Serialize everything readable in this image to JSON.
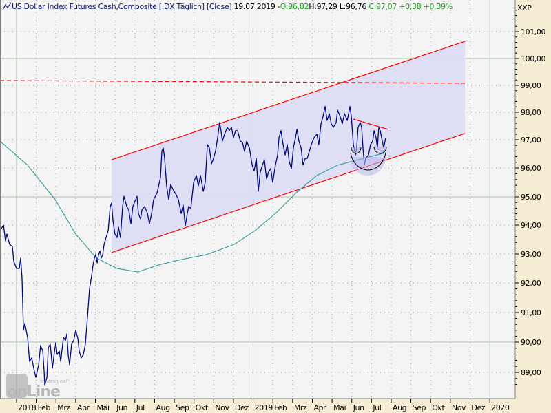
{
  "header": {
    "instrument": "US Dollar Index Futures Cash,Composite [.DX  Täglich] [Close]",
    "date": "19.07.2019",
    "sep": "-",
    "open": "O:96,82",
    "high": "H:97,29",
    "low": "L:96,76",
    "close": "C:97,07",
    "change": "+0,38",
    "change_pct": "+0,39%"
  },
  "logo": {
    "line1": "tradesignal",
    "line2": "onLine"
  },
  "colors": {
    "price": "#000a78",
    "ma": "#3aa0a0",
    "channel": "#ff0000",
    "channel_fill": "#dcdcf4",
    "grid": "#a9c4a9",
    "plot_bg": "#f4f4f4",
    "axis_bg": "#f5eed5"
  },
  "chart_data": {
    "type": "line",
    "title": "US Dollar Index Futures Cash,Composite [.DX Täglich] [Close]",
    "ylabel": "XXP",
    "x_unit": "months since Jan 2018",
    "ylim": [
      88.4,
      101.9
    ],
    "yscale": "log",
    "y_ticks": [
      "101,00",
      "100,00",
      "99,00",
      "98,00",
      "97,00",
      "96,00",
      "95,00",
      "94,00",
      "93,00",
      "92,00",
      "91,00",
      "90,00",
      "89,00"
    ],
    "x_ticks": [
      "2018",
      "Feb",
      "Mrz",
      "Apr",
      "Mai",
      "Jun",
      "Jul",
      "Aug",
      "Sep",
      "Okt",
      "Nov",
      "Dez",
      "2019",
      "Feb",
      "Mrz",
      "Apr",
      "Mai",
      "Jun",
      "Jul",
      "Aug",
      "Sep",
      "Okt",
      "Nov",
      "Dez",
      "2020"
    ],
    "grid": true,
    "series": [
      {
        "name": "Close",
        "points": [
          [
            -0.84,
            93.81
          ],
          [
            -0.66,
            94.0
          ],
          [
            -0.56,
            93.45
          ],
          [
            -0.49,
            93.69
          ],
          [
            -0.35,
            93.33
          ],
          [
            -0.21,
            93.26
          ],
          [
            -0.14,
            92.74
          ],
          [
            0,
            92.5
          ],
          [
            0.14,
            92.5
          ],
          [
            0.21,
            92.86
          ],
          [
            0.28,
            92.14
          ],
          [
            0.35,
            90.4
          ],
          [
            0.42,
            90.63
          ],
          [
            0.56,
            90.16
          ],
          [
            0.66,
            89.36
          ],
          [
            0.77,
            89.48
          ],
          [
            0.91,
            89.02
          ],
          [
            0.98,
            88.84
          ],
          [
            1.12,
            89.25
          ],
          [
            1.22,
            89.89
          ],
          [
            1.33,
            89.7
          ],
          [
            1.4,
            89.02
          ],
          [
            1.43,
            88.57
          ],
          [
            1.54,
            88.84
          ],
          [
            1.61,
            89.82
          ],
          [
            1.71,
            89.93
          ],
          [
            1.82,
            89.14
          ],
          [
            1.89,
            89.52
          ],
          [
            1.99,
            89.98
          ],
          [
            2.06,
            89.59
          ],
          [
            2.17,
            89.7
          ],
          [
            2.24,
            89.36
          ],
          [
            2.38,
            90.16
          ],
          [
            2.48,
            90.05
          ],
          [
            2.55,
            90.28
          ],
          [
            2.62,
            89.59
          ],
          [
            2.69,
            89.25
          ],
          [
            2.79,
            89.93
          ],
          [
            2.9,
            90.05
          ],
          [
            3.0,
            90.4
          ],
          [
            3.11,
            90.12
          ],
          [
            3.18,
            89.7
          ],
          [
            3.28,
            89.48
          ],
          [
            3.39,
            89.59
          ],
          [
            3.49,
            89.93
          ],
          [
            3.6,
            90.86
          ],
          [
            3.7,
            91.79
          ],
          [
            3.81,
            92.26
          ],
          [
            3.88,
            92.62
          ],
          [
            3.95,
            92.86
          ],
          [
            4.02,
            92.98
          ],
          [
            4.09,
            92.69
          ],
          [
            4.16,
            92.98
          ],
          [
            4.23,
            93.1
          ],
          [
            4.3,
            92.86
          ],
          [
            4.37,
            92.98
          ],
          [
            4.44,
            93.33
          ],
          [
            4.54,
            93.57
          ],
          [
            4.65,
            93.81
          ],
          [
            4.75,
            94.66
          ],
          [
            4.82,
            94.78
          ],
          [
            4.89,
            94.17
          ],
          [
            4.99,
            93.69
          ],
          [
            5.1,
            93.57
          ],
          [
            5.17,
            93.93
          ],
          [
            5.27,
            93.57
          ],
          [
            5.38,
            94.66
          ],
          [
            5.45,
            95.02
          ],
          [
            5.59,
            94.66
          ],
          [
            5.69,
            94.54
          ],
          [
            5.8,
            94.05
          ],
          [
            5.9,
            94.66
          ],
          [
            6.01,
            94.85
          ],
          [
            6.11,
            95.02
          ],
          [
            6.18,
            94.41
          ],
          [
            6.29,
            94.22
          ],
          [
            6.36,
            94.54
          ],
          [
            6.5,
            94.66
          ],
          [
            6.64,
            94.41
          ],
          [
            6.74,
            94.05
          ],
          [
            6.85,
            94.41
          ],
          [
            6.95,
            94.9
          ],
          [
            7.13,
            95.14
          ],
          [
            7.3,
            95.67
          ],
          [
            7.37,
            96.59
          ],
          [
            7.44,
            96.71
          ],
          [
            7.51,
            96.34
          ],
          [
            7.61,
            95.38
          ],
          [
            7.72,
            94.9
          ],
          [
            7.82,
            95.43
          ],
          [
            7.93,
            95.26
          ],
          [
            8.1,
            95.07
          ],
          [
            8.21,
            94.9
          ],
          [
            8.35,
            94.41
          ],
          [
            8.45,
            94.71
          ],
          [
            8.56,
            93.98
          ],
          [
            8.66,
            94.41
          ],
          [
            8.73,
            94.66
          ],
          [
            8.84,
            94.59
          ],
          [
            8.98,
            95.5
          ],
          [
            9.12,
            95.74
          ],
          [
            9.22,
            95.38
          ],
          [
            9.33,
            95.74
          ],
          [
            9.47,
            95.19
          ],
          [
            9.57,
            95.5
          ],
          [
            9.68,
            96.83
          ],
          [
            9.78,
            96.71
          ],
          [
            9.89,
            96.15
          ],
          [
            9.99,
            96.34
          ],
          [
            10.09,
            96.59
          ],
          [
            10.2,
            97.08
          ],
          [
            10.3,
            97.63
          ],
          [
            10.37,
            97.33
          ],
          [
            10.44,
            96.95
          ],
          [
            10.55,
            97.2
          ],
          [
            10.69,
            97.45
          ],
          [
            10.79,
            97.33
          ],
          [
            10.9,
            97.45
          ],
          [
            11.0,
            97.08
          ],
          [
            11.11,
            97.33
          ],
          [
            11.21,
            97.33
          ],
          [
            11.35,
            96.95
          ],
          [
            11.46,
            96.9
          ],
          [
            11.56,
            96.59
          ],
          [
            11.67,
            96.95
          ],
          [
            11.81,
            96.71
          ],
          [
            11.95,
            96.1
          ],
          [
            12.05,
            95.9
          ],
          [
            12.16,
            96.34
          ],
          [
            12.26,
            95.19
          ],
          [
            12.36,
            95.86
          ],
          [
            12.47,
            96.1
          ],
          [
            12.57,
            96.29
          ],
          [
            12.68,
            95.62
          ],
          [
            12.78,
            95.86
          ],
          [
            12.89,
            95.98
          ],
          [
            12.99,
            95.5
          ],
          [
            13.13,
            96.1
          ],
          [
            13.24,
            96.46
          ],
          [
            13.31,
            97.08
          ],
          [
            13.41,
            97.33
          ],
          [
            13.52,
            96.83
          ],
          [
            13.62,
            96.46
          ],
          [
            13.73,
            96.83
          ],
          [
            13.83,
            96.22
          ],
          [
            13.94,
            95.98
          ],
          [
            14.04,
            96.71
          ],
          [
            14.15,
            97.08
          ],
          [
            14.22,
            97.38
          ],
          [
            14.32,
            96.95
          ],
          [
            14.43,
            96.71
          ],
          [
            14.53,
            96.1
          ],
          [
            14.64,
            96.34
          ],
          [
            14.74,
            96.34
          ],
          [
            14.85,
            96.59
          ],
          [
            14.95,
            96.83
          ],
          [
            15.09,
            97.08
          ],
          [
            15.23,
            97.2
          ],
          [
            15.33,
            96.83
          ],
          [
            15.44,
            97.58
          ],
          [
            15.54,
            97.83
          ],
          [
            15.65,
            98.21
          ],
          [
            15.75,
            97.7
          ],
          [
            15.86,
            97.95
          ],
          [
            15.96,
            97.58
          ],
          [
            16.07,
            97.45
          ],
          [
            16.21,
            97.63
          ],
          [
            16.28,
            98.08
          ],
          [
            16.42,
            97.83
          ],
          [
            16.52,
            97.58
          ],
          [
            16.63,
            97.95
          ],
          [
            16.77,
            97.7
          ],
          [
            16.91,
            98.21
          ],
          [
            16.98,
            97.83
          ],
          [
            17.08,
            96.83
          ],
          [
            17.19,
            96.46
          ],
          [
            17.25,
            96.71
          ],
          [
            17.32,
            97.45
          ],
          [
            17.43,
            97.63
          ],
          [
            17.5,
            97.45
          ],
          [
            17.57,
            96.71
          ],
          [
            17.64,
            96.1
          ],
          [
            17.71,
            96.34
          ],
          [
            17.85,
            96.46
          ],
          [
            17.95,
            96.83
          ],
          [
            18.06,
            96.95
          ],
          [
            18.13,
            97.33
          ],
          [
            18.23,
            97.08
          ],
          [
            18.3,
            96.71
          ],
          [
            18.37,
            97.45
          ],
          [
            18.44,
            97.33
          ],
          [
            18.55,
            96.95
          ],
          [
            18.62,
            96.71
          ],
          [
            18.72,
            97.07
          ]
        ]
      },
      {
        "name": "Moving Average",
        "points": [
          [
            -0.84,
            96.95
          ],
          [
            0.56,
            96.1
          ],
          [
            1.96,
            94.9
          ],
          [
            3.0,
            93.69
          ],
          [
            4.05,
            92.86
          ],
          [
            5.1,
            92.5
          ],
          [
            6.15,
            92.38
          ],
          [
            7.2,
            92.62
          ],
          [
            8.24,
            92.79
          ],
          [
            9.64,
            92.98
          ],
          [
            11.04,
            93.33
          ],
          [
            12.09,
            93.81
          ],
          [
            13.13,
            94.41
          ],
          [
            14.18,
            95.14
          ],
          [
            15.23,
            95.74
          ],
          [
            16.28,
            96.1
          ],
          [
            17.32,
            96.29
          ],
          [
            18.72,
            96.54
          ]
        ]
      }
    ],
    "annotations": {
      "channel_upper": [
        [
          4.82,
          96.29
        ],
        [
          22.74,
          100.64
        ]
      ],
      "channel_lower": [
        [
          4.82,
          93.05
        ],
        [
          22.74,
          97.23
        ]
      ],
      "resistance_dashed": [
        [
          -0.84,
          99.18
        ],
        [
          22.74,
          99.08
        ]
      ],
      "short_trendline": [
        [
          17.08,
          97.75
        ],
        [
          18.83,
          97.38
        ]
      ]
    }
  }
}
